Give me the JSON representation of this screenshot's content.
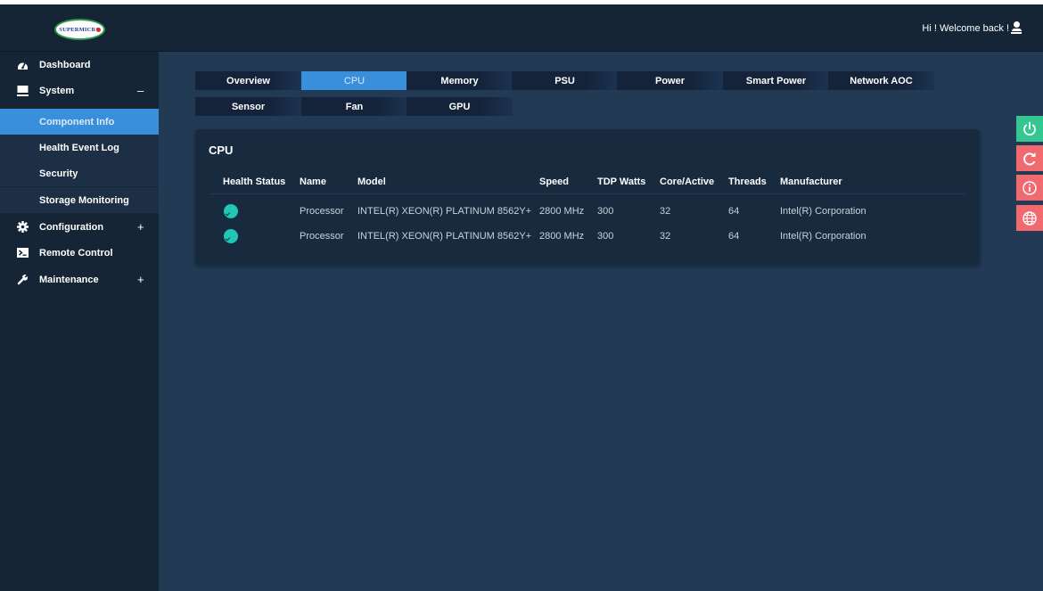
{
  "header": {
    "logo_text": "SUPERMICRO",
    "welcome": "Hi ! Welcome back !"
  },
  "sidebar": {
    "items": [
      {
        "label": "Dashboard",
        "icon": "dashboard-icon",
        "toggle": ""
      },
      {
        "label": "System",
        "icon": "monitor-icon",
        "toggle": "–"
      },
      {
        "label": "Configuration",
        "icon": "gear-icon",
        "toggle": "+"
      },
      {
        "label": "Remote Control",
        "icon": "terminal-icon",
        "toggle": ""
      },
      {
        "label": "Maintenance",
        "icon": "wrench-icon",
        "toggle": "+"
      }
    ],
    "sub_items": [
      {
        "label": "Component Info",
        "active": true
      },
      {
        "label": "Health Event Log",
        "active": false
      },
      {
        "label": "Security",
        "active": false
      },
      {
        "label": "Storage Monitoring",
        "active": false
      }
    ]
  },
  "tabs": [
    {
      "label": "Overview",
      "active": false
    },
    {
      "label": "CPU",
      "active": true
    },
    {
      "label": "Memory",
      "active": false
    },
    {
      "label": "PSU",
      "active": false
    },
    {
      "label": "Power",
      "active": false
    },
    {
      "label": "Smart Power",
      "active": false
    },
    {
      "label": "Network AOC",
      "active": false
    },
    {
      "label": "Sensor",
      "active": false
    },
    {
      "label": "Fan",
      "active": false
    },
    {
      "label": "GPU",
      "active": false
    }
  ],
  "card": {
    "title": "CPU",
    "columns": [
      "Health Status",
      "Name",
      "Model",
      "Speed",
      "TDP Watts",
      "Core/Active",
      "Threads",
      "Manufacturer"
    ],
    "rows": [
      {
        "health": "ok",
        "name": "Processor",
        "model": "INTEL(R) XEON(R) PLATINUM 8562Y+",
        "speed": "2800 MHz",
        "tdp": "300",
        "cores": "32",
        "threads": "64",
        "manufacturer": "Intel(R) Corporation"
      },
      {
        "health": "ok",
        "name": "Processor",
        "model": "INTEL(R) XEON(R) PLATINUM 8562Y+",
        "speed": "2800 MHz",
        "tdp": "300",
        "cores": "32",
        "threads": "64",
        "manufacturer": "Intel(R) Corporation"
      }
    ]
  },
  "floating_buttons": [
    {
      "icon": "power-icon",
      "color": "#34c792"
    },
    {
      "icon": "refresh-icon",
      "color": "#f06a6f"
    },
    {
      "icon": "info-icon",
      "color": "#f06a6f"
    },
    {
      "icon": "globe-icon",
      "color": "#f06a6f"
    }
  ],
  "colors": {
    "background": "#223a54",
    "sidebar": "#152536",
    "accent": "#3a8fdd",
    "health_ok": "#22c5b6"
  }
}
